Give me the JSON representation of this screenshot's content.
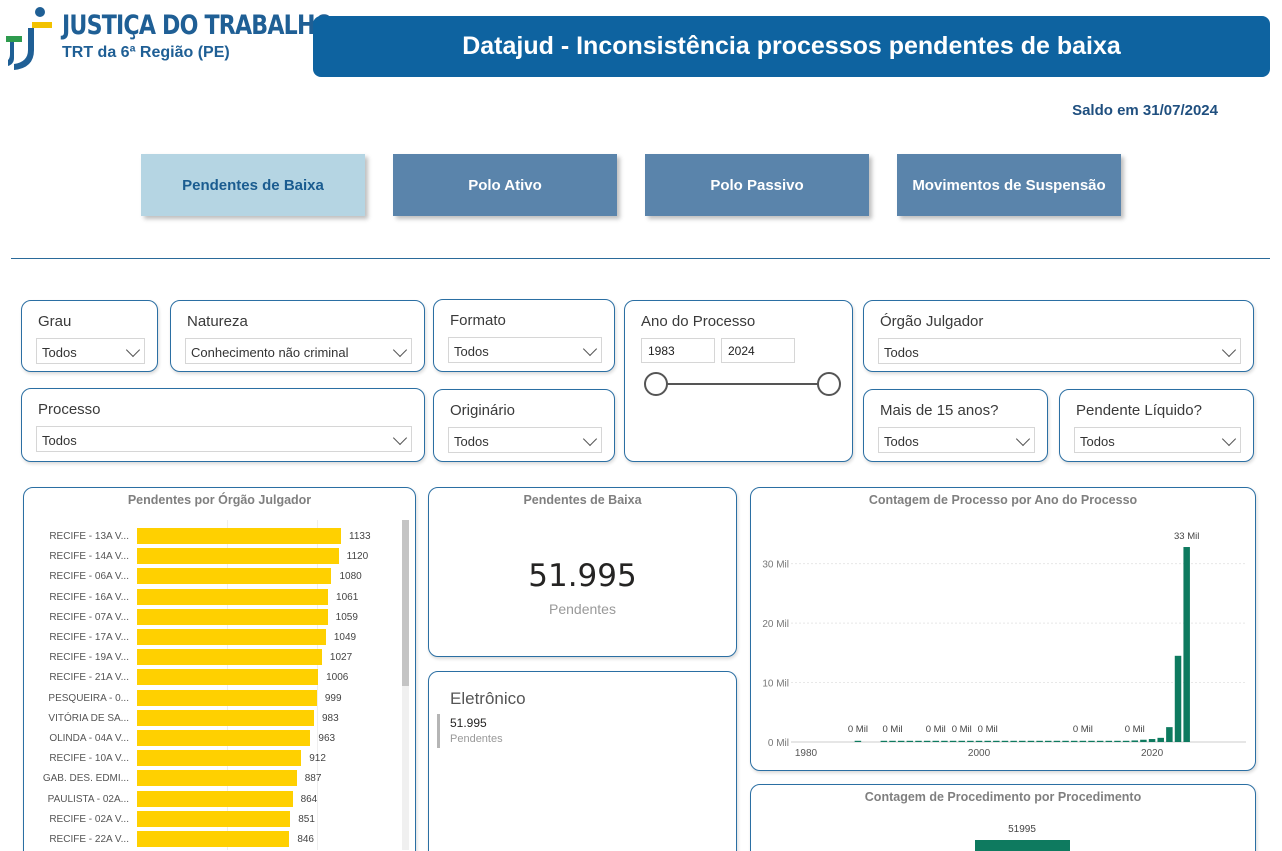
{
  "logo": {
    "line1": "JUSTIÇA DO TRABALHO",
    "line2": "TRT da 6ª Região (PE)"
  },
  "header": {
    "title": "Datajud - Inconsistência processos pendentes de baixa",
    "saldo": "Saldo em 31/07/2024"
  },
  "nav": {
    "pendentes": "Pendentes de Baixa",
    "polo_ativo": "Polo Ativo",
    "polo_passivo": "Polo Passivo",
    "suspensao": "Movimentos de Suspensão"
  },
  "filters": {
    "grau": {
      "label": "Grau",
      "value": "Todos"
    },
    "natureza": {
      "label": "Natureza",
      "value": "Conhecimento não criminal"
    },
    "formato": {
      "label": "Formato",
      "value": "Todos"
    },
    "ano": {
      "label": "Ano do Processo",
      "from": "1983",
      "to": "2024"
    },
    "orgao": {
      "label": "Órgão Julgador",
      "value": "Todos"
    },
    "processo": {
      "label": "Processo",
      "value": "Todos"
    },
    "originario": {
      "label": "Originário",
      "value": "Todos"
    },
    "mais15": {
      "label": "Mais de 15 anos?",
      "value": "Todos"
    },
    "liquido": {
      "label": "Pendente Líquido?",
      "value": "Todos"
    }
  },
  "kpi": {
    "title": "Pendentes de Baixa",
    "value": "51.995",
    "label": "Pendentes"
  },
  "multirow": {
    "title": "Eletrônico",
    "value": "51.995",
    "label": "Pendentes"
  },
  "colors": {
    "primary": "#0e63a0",
    "nav": "#5a84ab",
    "nav_active": "#b5d5e3",
    "bar_yellow": "#ffd000",
    "bar_green": "#0e7a5f"
  },
  "chart_data": [
    {
      "type": "bar",
      "orientation": "horizontal",
      "title": "Pendentes por Órgão Julgador",
      "categories": [
        "RECIFE - 13A V...",
        "RECIFE - 14A V...",
        "RECIFE - 06A V...",
        "RECIFE - 16A V...",
        "RECIFE - 07A V...",
        "RECIFE - 17A V...",
        "RECIFE - 19A V...",
        "RECIFE - 21A V...",
        "PESQUEIRA - 0...",
        "VITÓRIA DE SA...",
        "OLINDA - 04A V...",
        "RECIFE - 10A V...",
        "GAB. DES. EDMI...",
        "PAULISTA - 02A...",
        "RECIFE - 02A V...",
        "RECIFE - 22A V..."
      ],
      "values": [
        1133,
        1120,
        1080,
        1061,
        1059,
        1049,
        1027,
        1006,
        999,
        983,
        963,
        912,
        887,
        864,
        851,
        846
      ]
    },
    {
      "type": "bar",
      "title": "Contagem de Processo por Ano do Processo",
      "x_ticks": [
        "1980",
        "2000",
        "2020"
      ],
      "y_ticks": [
        "0 Mil",
        "10 Mil",
        "20 Mil",
        "30 Mil"
      ],
      "ylim": [
        0,
        36000
      ],
      "x": [
        1986,
        1989,
        1990,
        1991,
        1992,
        1993,
        1994,
        1995,
        1996,
        1997,
        1998,
        1999,
        2000,
        2001,
        2002,
        2003,
        2004,
        2005,
        2006,
        2007,
        2008,
        2009,
        2010,
        2011,
        2012,
        2013,
        2014,
        2015,
        2016,
        2017,
        2018,
        2019,
        2020,
        2021,
        2022,
        2023,
        2024
      ],
      "values": [
        120,
        10,
        15,
        20,
        25,
        20,
        15,
        30,
        35,
        25,
        30,
        25,
        30,
        25,
        35,
        40,
        30,
        35,
        40,
        45,
        50,
        35,
        45,
        60,
        70,
        80,
        90,
        100,
        130,
        200,
        260,
        380,
        500,
        700,
        2500,
        14500,
        32800
      ],
      "data_labels": [
        {
          "x": 1986,
          "text": "0 Mil"
        },
        {
          "x": 1990,
          "text": "0 Mil"
        },
        {
          "x": 1995,
          "text": "0 Mil"
        },
        {
          "x": 1998,
          "text": "0 Mil"
        },
        {
          "x": 2001,
          "text": "0 Mil"
        },
        {
          "x": 2012,
          "text": "0 Mil"
        },
        {
          "x": 2018,
          "text": "0 Mil"
        },
        {
          "x": 2024,
          "text": "33 Mil"
        }
      ]
    },
    {
      "type": "bar",
      "title": "Contagem de Procedimento por Procedimento",
      "values": [
        51995
      ],
      "data_labels": [
        "51995"
      ]
    }
  ]
}
